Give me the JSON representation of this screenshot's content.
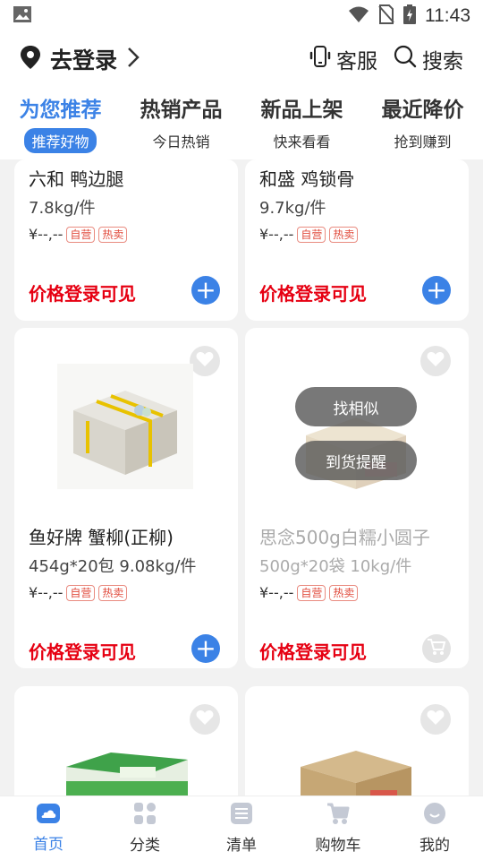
{
  "status_bar": {
    "time": "11:43"
  },
  "header": {
    "login_label": "去登录",
    "service_label": "客服",
    "search_label": "搜索"
  },
  "tabs": [
    {
      "title": "为您推荐",
      "subtitle": "推荐好物"
    },
    {
      "title": "热销产品",
      "subtitle": "今日热销"
    },
    {
      "title": "新品上架",
      "subtitle": "快来看看"
    },
    {
      "title": "最近降价",
      "subtitle": "抢到赚到"
    }
  ],
  "products": [
    {
      "name": "六和 鸭边腿",
      "spec": "7.8kg/件",
      "price": "¥--,--",
      "tag1": "自营",
      "tag2": "热卖",
      "login_price": "价格登录可见"
    },
    {
      "name": "和盛 鸡锁骨",
      "spec": "9.7kg/件",
      "price": "¥--,--",
      "tag1": "自营",
      "tag2": "热卖",
      "login_price": "价格登录可见"
    },
    {
      "name": "鱼好牌 蟹柳(正柳)",
      "spec": "454g*20包 9.08kg/件",
      "price": "¥--,--",
      "tag1": "自营",
      "tag2": "热卖",
      "login_price": "价格登录可见"
    },
    {
      "name": "思念500g白糯小圆子",
      "spec": "500g*20袋 10kg/件",
      "price": "¥--,--",
      "tag1": "自营",
      "tag2": "热卖",
      "login_price": "价格登录可见",
      "overlay_similar": "找相似",
      "overlay_notify": "到货提醒"
    }
  ],
  "bottom_nav": [
    {
      "label": "首页"
    },
    {
      "label": "分类"
    },
    {
      "label": "清单"
    },
    {
      "label": "购物车"
    },
    {
      "label": "我的"
    }
  ],
  "colors": {
    "accent": "#3b82e6",
    "price_red": "#e60012",
    "tag_red": "#e04a3b"
  }
}
